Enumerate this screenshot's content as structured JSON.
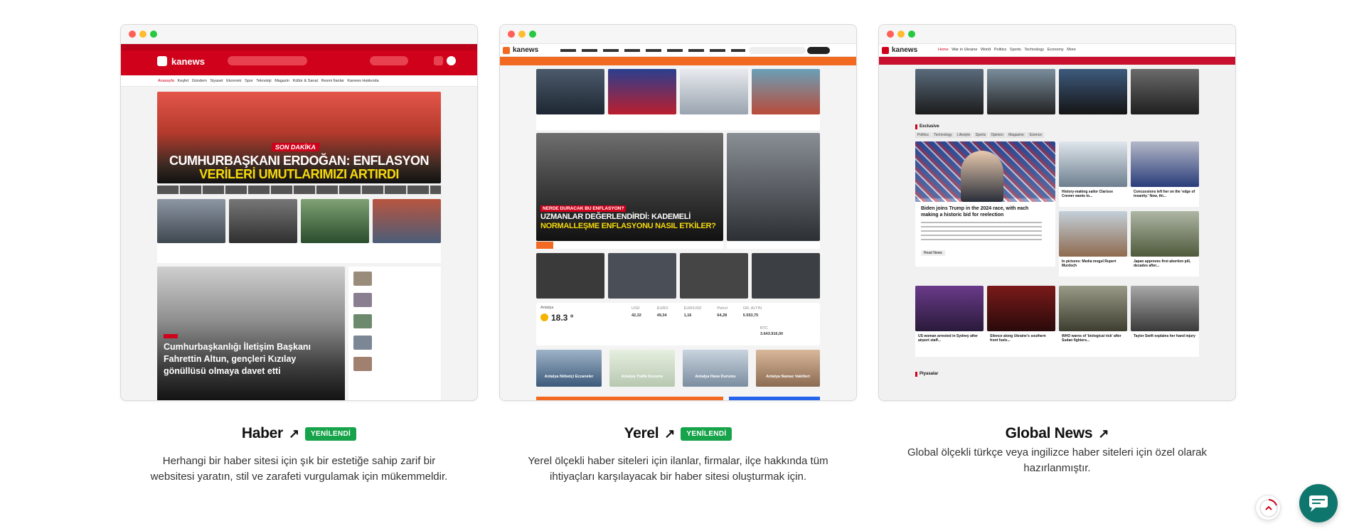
{
  "cards": [
    {
      "title": "Haber",
      "badge": "YENİLENDİ",
      "description": "Herhangi bir haber sitesi için şık bir estetiğe sahip zarif bir websitesi yaratın, stil ve zarafeti vurgulamak için mükemmeldir.",
      "preview": {
        "brand": "kanews",
        "nav": [
          "Anasayfa",
          "Keşfet",
          "Gündem",
          "Siyaset",
          "Ekonomi",
          "Spor",
          "Teknoloji",
          "Magazin",
          "Kültür & Sanat",
          "Resmi İlanlar",
          "Kanews Hakkında"
        ],
        "headline_tag": "SON DAKİKA",
        "headline_line1": "CUMHURBAŞKANI ERDOĞAN: ENFLASYON",
        "headline_line2": "VERİLERİ UMUTLARIMIZI ARTIRDI",
        "feature_caption": "Cumhurbaşkanlığı İletişim Başkanı Fahrettin Altun, gençleri Kızılay gönüllüsü olmaya davet etti"
      }
    },
    {
      "title": "Yerel",
      "badge": "YENİLENDİ",
      "description": "Yerel ölçekli haber siteleri için ilanlar, firmalar, ilçe hakkında tüm ihtiyaçları karşılayacak bir haber sitesi oluşturmak için.",
      "preview": {
        "brand": "kanews",
        "headline_tag": "NERDE DURACAK BU ENFLASYON?",
        "headline_line1": "UZMANLAR DEĞERLENDİRDİ: KADEMELİ",
        "headline_line2": "NORMALLEŞME ENFLASYONU NASIL ETKİLER?",
        "weather": "18.3 °",
        "city": "Antalya",
        "currencies": [
          {
            "name": "USD",
            "value": "42,32"
          },
          {
            "name": "EURO",
            "value": "49,34"
          },
          {
            "name": "EUR/USD",
            "value": "1,16"
          },
          {
            "name": "Petrol",
            "value": "64,28"
          },
          {
            "name": "GR. ALTIN",
            "value": "5.553,75"
          },
          {
            "name": "BTC",
            "value": "3.643.916,00"
          }
        ],
        "tiles": [
          "Antalya Nöbetçi Eczaneler",
          "Antalya Trafik Durumu",
          "Antalya Hava Durumu",
          "Antalya Namaz Vakitleri"
        ]
      }
    },
    {
      "title": "Global News",
      "badge": "",
      "description": "Global ölçekli türkçe veya ingilizce haber siteleri için özel olarak hazırlanmıştır.",
      "preview": {
        "brand": "kanews",
        "nav": [
          "Home",
          "War in Ukraine",
          "World",
          "Politics",
          "Sports",
          "Technology",
          "Economy",
          "More"
        ],
        "exclusive": "Exclusive",
        "tabs": [
          "Politics",
          "Technology",
          "Lifestyle",
          "Sports",
          "Opinion",
          "Magazine",
          "Science"
        ],
        "lead_title": "Biden joins Trump in the 2024 race, with each making a historic bid for reelection",
        "read_more": "Read News",
        "markets": "Piyasalar",
        "grid_titles": [
          "History-making sailor Clarisse Cremer wants to...",
          "Concussions left her on the 'edge of insanity.' Now, thi...",
          "In pictures: Media mogul Rupert Murdoch",
          "Japan approves first abortion pill, decades after...",
          "US woman arrested in Sydney after airport staff...",
          "Silence along Ukraine's southern front fuels...",
          "WHO warns of 'biological risk' after Sudan fighters...",
          "Taylor Swift explains her hand injury"
        ]
      }
    }
  ],
  "colors": {
    "brand_red": "#d0021b",
    "orange": "#f26a21",
    "badge_green": "#16a34a",
    "chat_green": "#0f766e"
  }
}
